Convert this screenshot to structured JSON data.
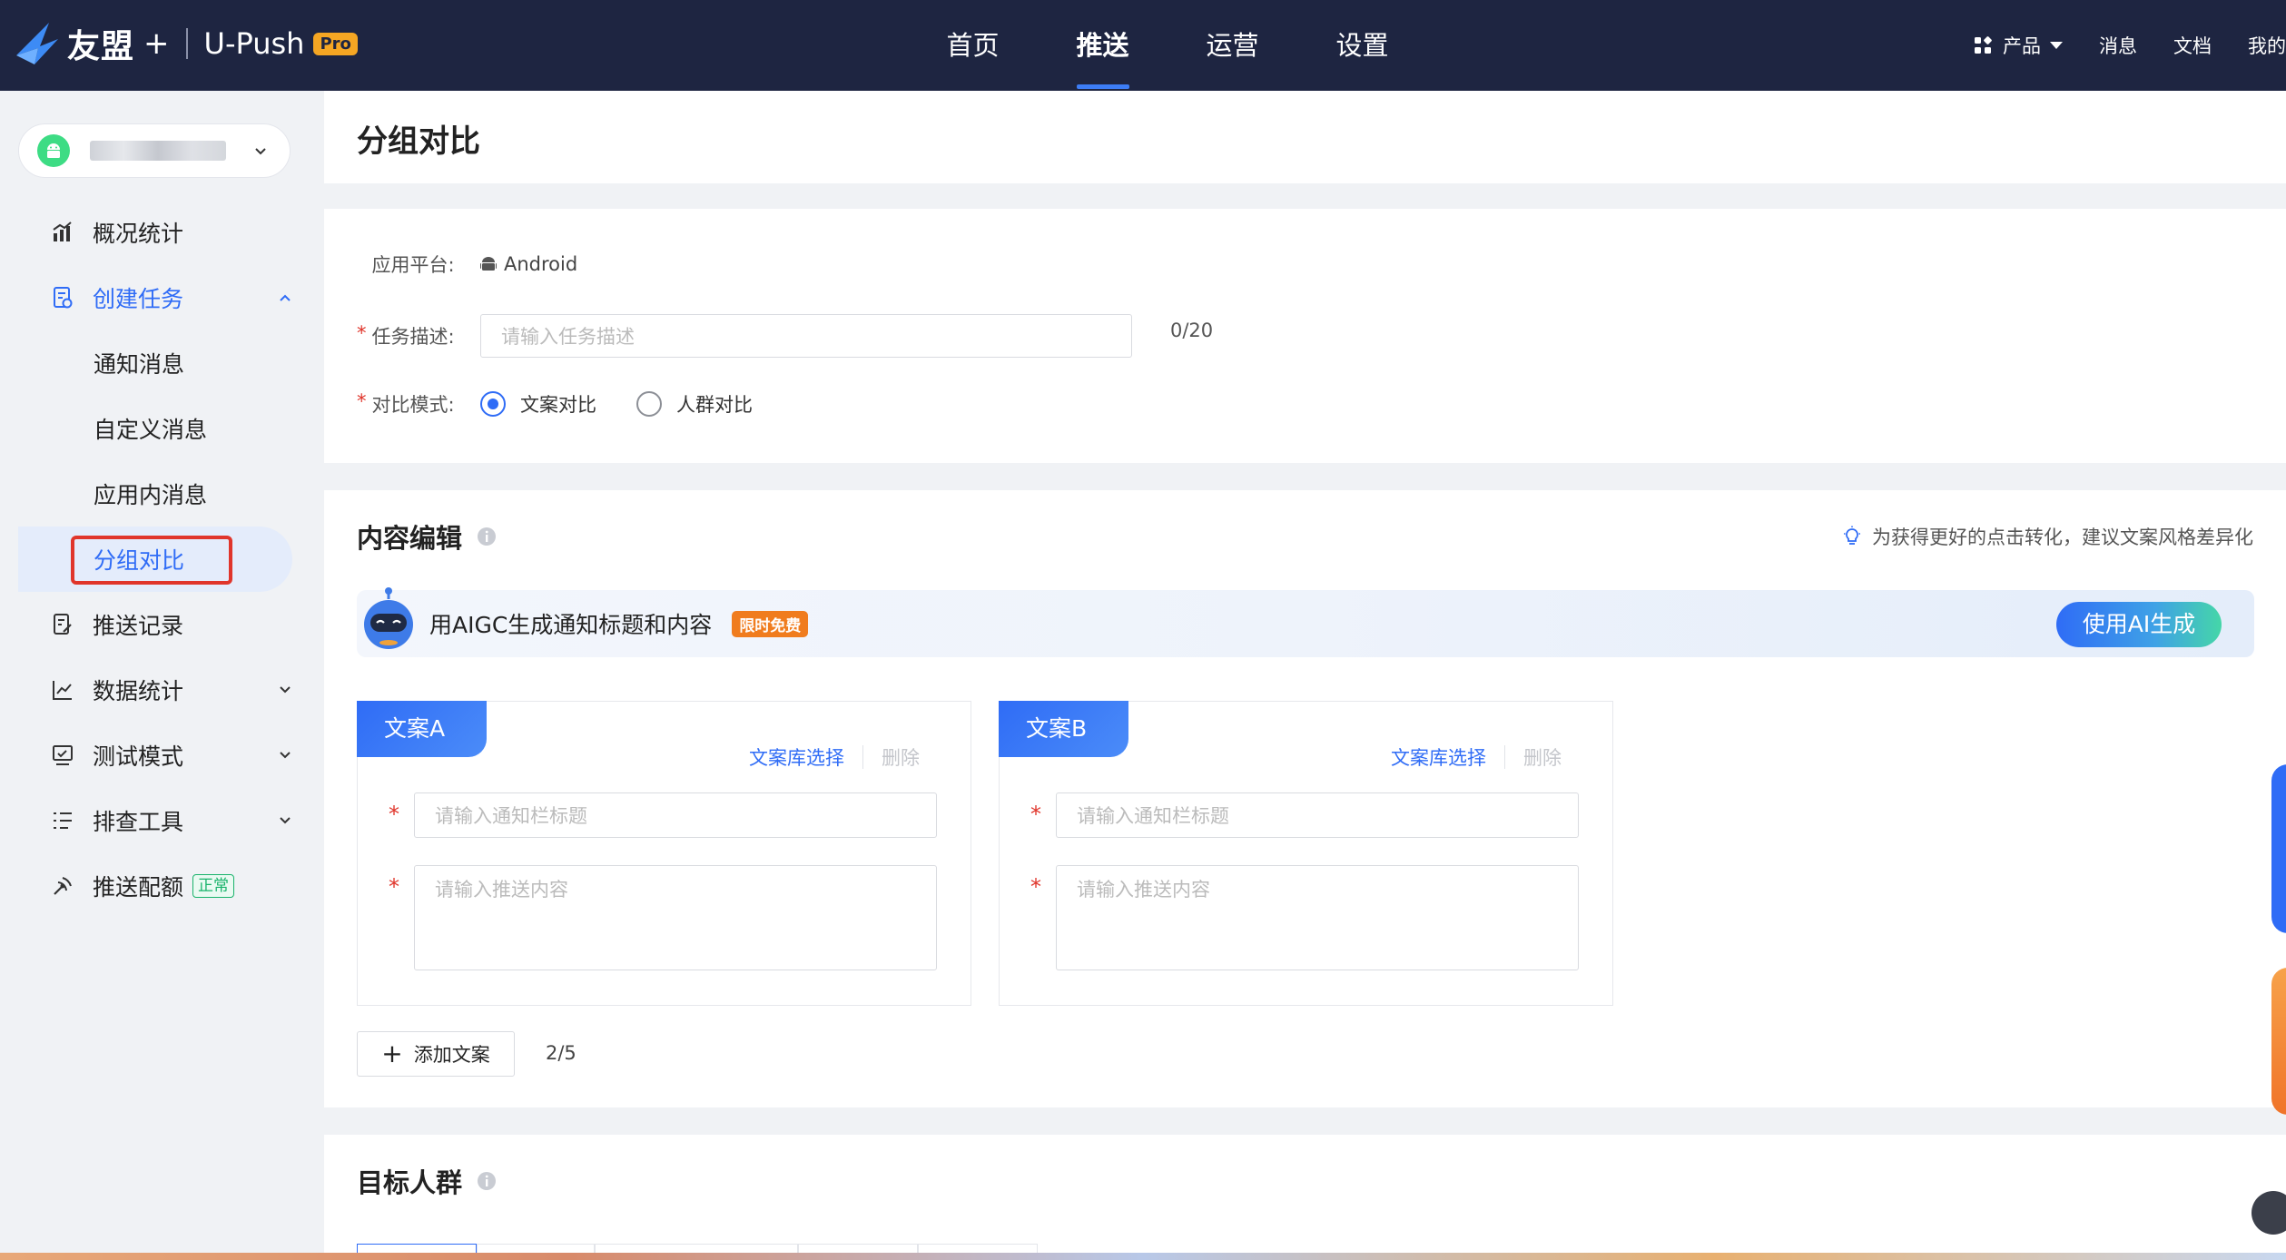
{
  "topbar": {
    "brand": "友盟",
    "brand_plus": "+",
    "product": "U-Push",
    "pro_badge": "Pro",
    "nav": [
      {
        "label": "首页",
        "active": false
      },
      {
        "label": "推送",
        "active": true
      },
      {
        "label": "运营",
        "active": false
      },
      {
        "label": "设置",
        "active": false
      }
    ],
    "right": {
      "products": "产品",
      "messages": "消息",
      "docs": "文档",
      "mine": "我的"
    }
  },
  "sidebar": {
    "app_icon": "android-icon",
    "items": [
      {
        "label": "概况统计",
        "icon": "chart-icon"
      },
      {
        "label": "创建任务",
        "icon": "task-icon",
        "open": true
      },
      {
        "label": "推送记录",
        "icon": "record-icon"
      },
      {
        "label": "数据统计",
        "icon": "line-chart-icon"
      },
      {
        "label": "测试模式",
        "icon": "monitor-icon"
      },
      {
        "label": "排查工具",
        "icon": "list-icon"
      },
      {
        "label": "推送配额",
        "icon": "satellite-icon",
        "tag": "正常"
      }
    ],
    "submenu": [
      {
        "label": "通知消息"
      },
      {
        "label": "自定义消息"
      },
      {
        "label": "应用内消息"
      },
      {
        "label": "分组对比",
        "active": true
      }
    ]
  },
  "page": {
    "title": "分组对比"
  },
  "basic": {
    "platform_label": "应用平台:",
    "platform_value": "Android",
    "desc_label": "任务描述:",
    "desc_placeholder": "请输入任务描述",
    "desc_counter": "0/20",
    "mode_label": "对比模式:",
    "mode_options": [
      {
        "label": "文案对比",
        "selected": true
      },
      {
        "label": "人群对比",
        "selected": false
      }
    ]
  },
  "content": {
    "title": "内容编辑",
    "tip": "为获得更好的点击转化，建议文案风格差异化",
    "aigc_text": "用AIGC生成通知标题和内容",
    "free_tag": "限时免费",
    "ai_button": "使用AI生成",
    "copies": [
      {
        "tab": "文案A",
        "lib": "文案库选择",
        "delete": "删除",
        "title_placeholder": "请输入通知栏标题",
        "body_placeholder": "请输入推送内容"
      },
      {
        "tab": "文案B",
        "lib": "文案库选择",
        "delete": "删除",
        "title_placeholder": "请输入通知栏标题",
        "body_placeholder": "请输入推送内容"
      }
    ],
    "add_copy": "添加文案",
    "copy_count": "2/5"
  },
  "target": {
    "title": "目标人群"
  },
  "colors": {
    "nav_bg": "#1e2541",
    "accent": "#2f6cf6",
    "required": "#e0352b",
    "highlight_box": "#e0352b",
    "status_green": "#19b36b"
  }
}
